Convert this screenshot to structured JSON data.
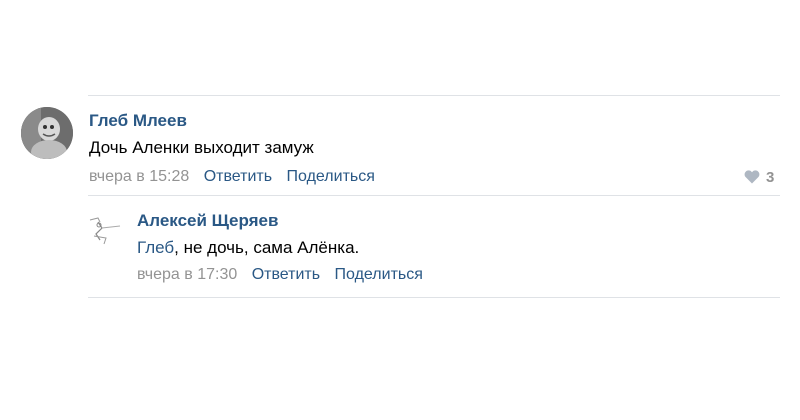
{
  "comments": [
    {
      "author": "Глеб Млеев",
      "text": "Дочь Аленки выходит замуж",
      "date": "вчера в 15:28",
      "reply_label": "Ответить",
      "share_label": "Поделиться",
      "likes": "3",
      "avatar_icon": "profile-photo"
    }
  ],
  "reply": {
    "author": "Алексей Щеряев",
    "mention": "Глеб",
    "text_rest": ", не дочь, сама Алёнка.",
    "date": "вчера в 17:30",
    "reply_label": "Ответить",
    "share_label": "Поделиться",
    "avatar_icon": "sketch-avatar"
  },
  "colors": {
    "link": "#2a5885",
    "meta": "#939393",
    "divider": "#dfe2e6"
  }
}
